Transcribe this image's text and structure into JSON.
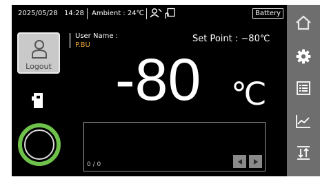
{
  "status": {
    "date": "2025/05/28",
    "time": "14:28",
    "ambient": "Ambient : 24℃",
    "battery": "Battery"
  },
  "user": {
    "label": "User Name :",
    "name": "P.BU"
  },
  "logout": {
    "label": "Logout"
  },
  "setpoint": {
    "text": "Set Point :  −80℃"
  },
  "temperature": {
    "value": "-80",
    "unit": "℃"
  },
  "graph": {
    "counter": "0 / 0"
  },
  "nav": [
    "home-icon",
    "gear-icon",
    "list-icon",
    "chart-icon",
    "transfer-icon"
  ],
  "colors": {
    "accent_ring": "#6ec14a",
    "user_name": "#e8a33a",
    "sidebar": "#6e6e6e"
  }
}
